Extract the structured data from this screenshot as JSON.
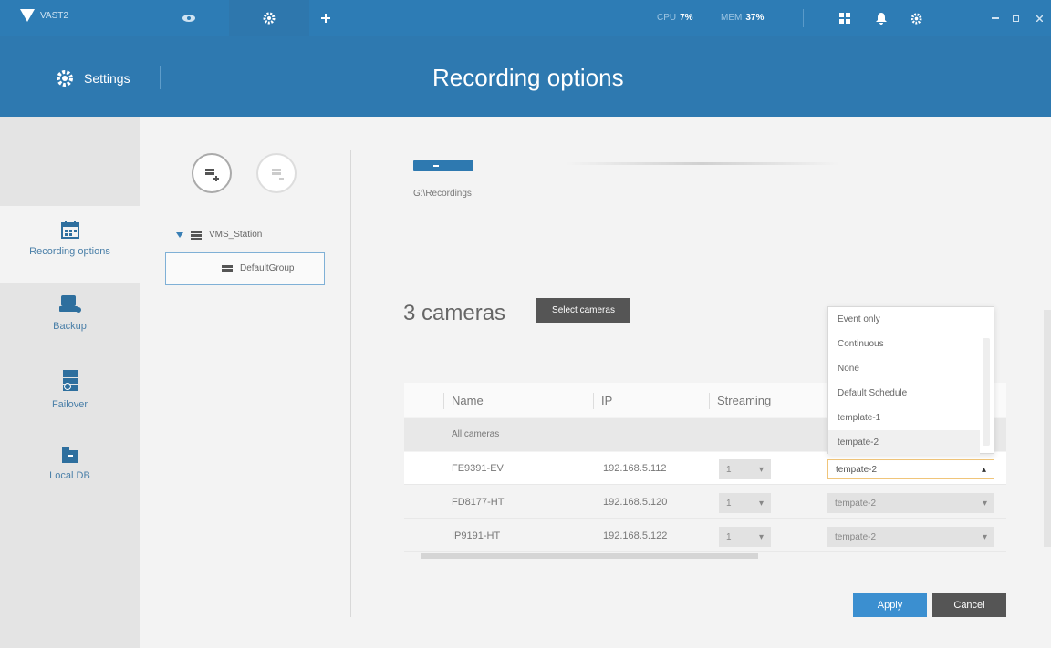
{
  "app": {
    "name": "VAST2",
    "cpu_label": "CPU",
    "cpu_value": "7%",
    "mem_label": "MEM",
    "mem_value": "37%"
  },
  "header": {
    "settings_label": "Settings",
    "page_title": "Recording options"
  },
  "sidebar": {
    "items": [
      {
        "label": "Recording options",
        "icon": "calendar-icon"
      },
      {
        "label": "Backup",
        "icon": "backup-drive-icon"
      },
      {
        "label": "Failover",
        "icon": "failover-server-icon"
      },
      {
        "label": "Local DB",
        "icon": "local-db-icon"
      }
    ]
  },
  "tree": {
    "station": "VMS_Station",
    "group": "DefaultGroup"
  },
  "storage": {
    "path": "G:\\Recordings"
  },
  "cameras": {
    "count_label": "3 cameras",
    "select_button": "Select cameras",
    "columns": [
      "Name",
      "IP",
      "Streaming"
    ],
    "all_label": "All cameras",
    "rows": [
      {
        "name": "FE9391-EV",
        "ip": "192.168.5.112",
        "stream": "1",
        "schedule": "tempate-2"
      },
      {
        "name": "FD8177-HT",
        "ip": "192.168.5.120",
        "stream": "1",
        "schedule": "tempate-2"
      },
      {
        "name": "IP9191-HT",
        "ip": "192.168.5.122",
        "stream": "1",
        "schedule": "tempate-2"
      }
    ]
  },
  "schedule_dropdown": {
    "options": [
      "Event only",
      "Continuous",
      "None",
      "Default Schedule",
      "template-1",
      "tempate-2"
    ],
    "highlighted": "tempate-2"
  },
  "buttons": {
    "apply": "Apply",
    "cancel": "Cancel"
  },
  "colors": {
    "brand_blue": "#2e79b0",
    "apply_blue": "#3b8fd0",
    "dark_button": "#555555"
  }
}
